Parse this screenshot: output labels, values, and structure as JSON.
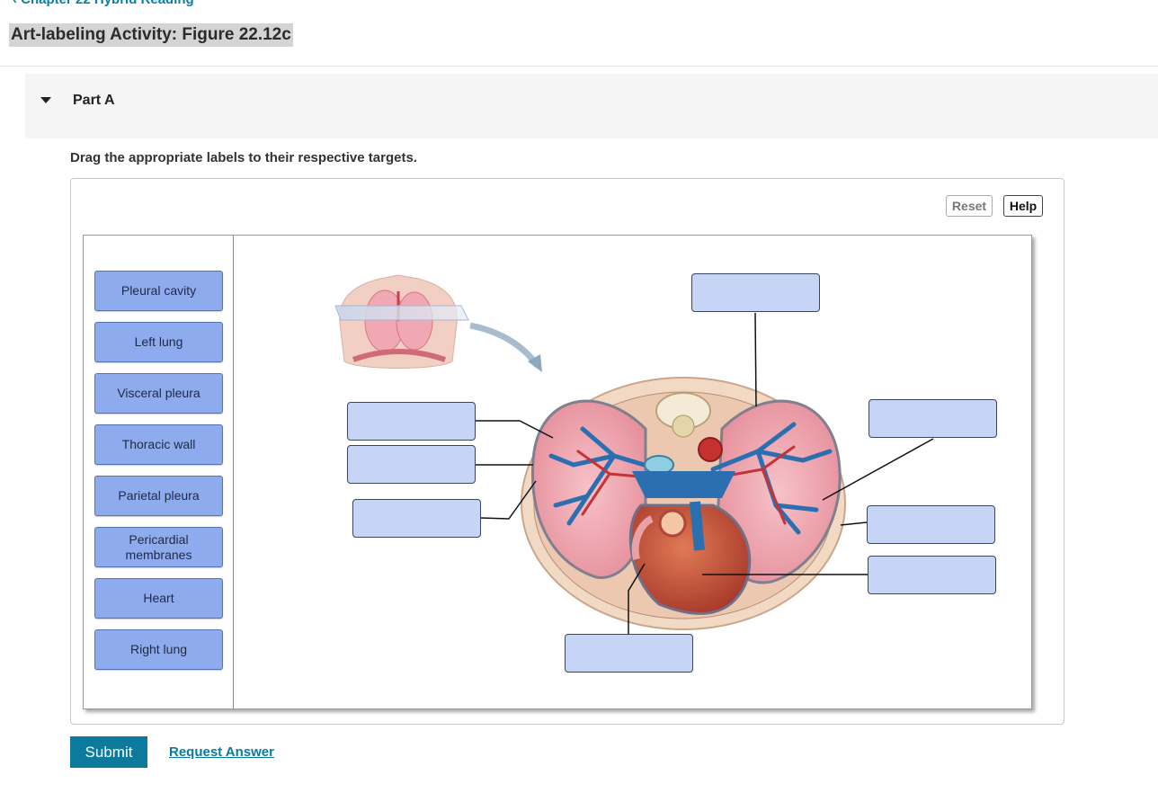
{
  "header": {
    "top_link_text": "‹ Chapter 22 Hybrid Reading",
    "page_title": "Art-labeling Activity: Figure 22.12c"
  },
  "part": {
    "label": "Part A"
  },
  "instructions": "Drag the appropriate labels to their respective targets.",
  "toolbar": {
    "reset_label": "Reset",
    "help_label": "Help"
  },
  "labels": [
    "Pleural cavity",
    "Left lung",
    "Visceral pleura",
    "Thoracic wall",
    "Parietal pleura",
    "Pericardial membranes",
    "Heart",
    "Right lung"
  ],
  "targets": [
    {
      "filled_label": ""
    },
    {
      "filled_label": ""
    },
    {
      "filled_label": ""
    },
    {
      "filled_label": ""
    },
    {
      "filled_label": ""
    },
    {
      "filled_label": ""
    },
    {
      "filled_label": ""
    },
    {
      "filled_label": ""
    }
  ],
  "footer": {
    "submit_label": "Submit",
    "request_answer_label": "Request Answer"
  },
  "colors": {
    "label_fill": "#8eabee",
    "target_fill": "#c6d4f6",
    "submit_fill": "#0b7a9c",
    "link": "#0b7a9c"
  }
}
